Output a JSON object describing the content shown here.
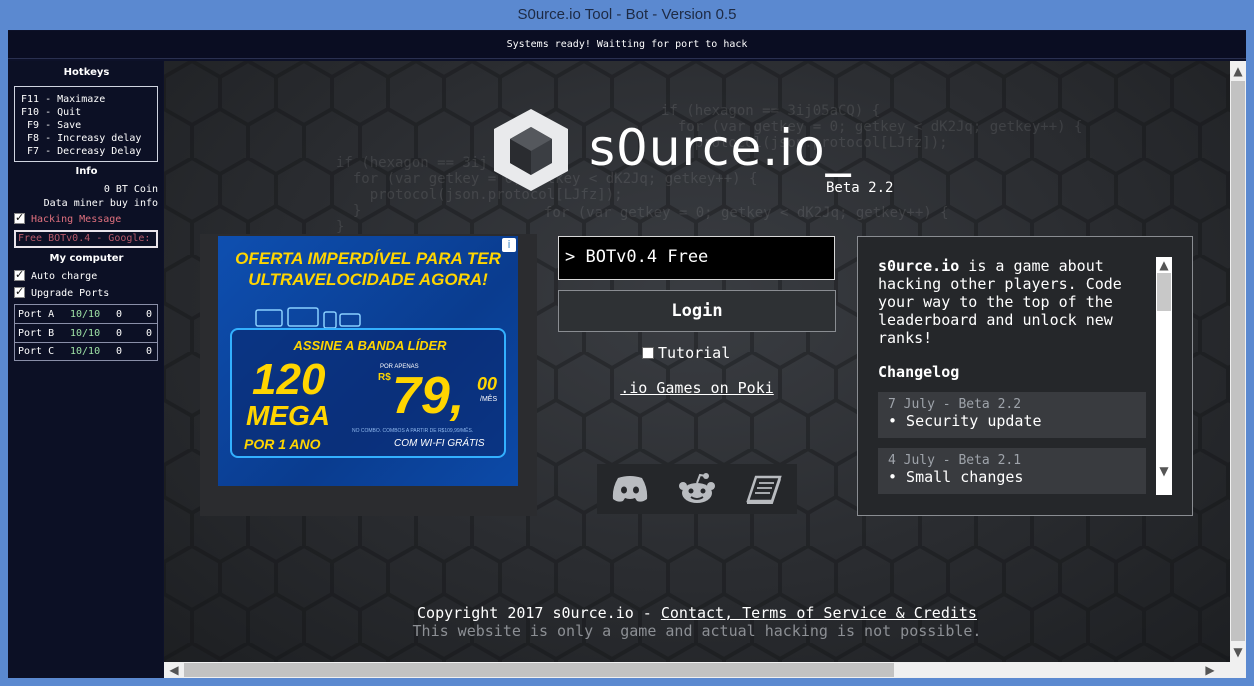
{
  "window": {
    "title": "S0urce.io Tool - Bot - Version 0.5"
  },
  "status": {
    "message": "Systems ready! Waitting for port to hack"
  },
  "left_panel": {
    "hotkeys_title": "Hotkeys",
    "hotkeys": [
      "F11 - Maximaze",
      "F10 - Quit",
      " F9 - Save",
      " F8 - Increasy delay",
      " F7 - Decreasy Delay"
    ],
    "info_title": "Info",
    "coin": "0 BT Coin",
    "data_miner": "Data miner buy info",
    "hacking_message_label": "Hacking Message",
    "hacking_message_value": "Free BOTv0.4 - Google:",
    "my_computer_title": "My computer",
    "auto_charge_label": "Auto charge",
    "upgrade_ports_label": "Upgrade Ports",
    "ports": [
      {
        "name": "Port A",
        "value": "10/10",
        "a": "0",
        "b": "0"
      },
      {
        "name": "Port B",
        "value": "10/10",
        "a": "0",
        "b": "0"
      },
      {
        "name": "Port C",
        "value": "10/10",
        "a": "0",
        "b": "0"
      }
    ]
  },
  "game": {
    "logo_text": "s0urce.io_",
    "beta": "Beta 2.2",
    "bg_code": [
      "if (hexagon == 3ij05aCQ) {\n  for (var getkey = 0; getkey < dK2Jq; getkey++) {\n    protocol(json.protocol[LJfz]);",
      "if (hexagon == 3ij\n  for (var getkey = 0; getkey < dK2Jq; getkey++) {\n    protocol(json.protocol[LJfz]);\n  }\n}",
      "for (var getkey = 0; getkey < dK2Jq; getkey++) {"
    ],
    "name_input_value": "> BOTv0.4 Free",
    "login_label": "Login",
    "tutorial_label": "Tutorial",
    "poki_link": ".io Games on Poki",
    "description_name": "s0urce.io",
    "description_rest": " is a game about hacking other players. Code your way to the top of the leaderboard and unlock new ranks!",
    "changelog_title": "Changelog",
    "changelog": [
      {
        "date": "7 July - Beta 2.2",
        "item": "• Security update"
      },
      {
        "date": "4 July - Beta 2.1",
        "item": "• Small changes"
      }
    ],
    "copyright_prefix": "Copyright 2017 s0urce.io - ",
    "copyright_link": "Contact, Terms of Service & Credits",
    "disclaimer": "This website is only a game and actual hacking is not possible."
  },
  "ad": {
    "headline": "OFERTA IMPERDÍVEL PARA TER ULTRAVELOCIDADE AGORA!",
    "subhead": "ASSINE A BANDA LÍDER",
    "mega_number": "120",
    "mega_label": "MEGA",
    "year": "POR 1 ANO",
    "por_apenas": "POR APENAS",
    "currency": "R$",
    "price": "79,",
    "cents": "00",
    "per_month": "/MÊS",
    "fine_print": "NO COMBO. COMBOS A PARTIR DE R$109,99/MÊS.",
    "wifi": "COM WI-FI GRÁTIS"
  },
  "colors": {
    "titlebar": "#5b89d0",
    "panel_bg": "#0c1025",
    "game_bg": "#2a2c30",
    "port_value": "#9fe3a6",
    "hacking_message": "#b85a6a",
    "ad_yellow": "#ffd500",
    "ad_blue": "#0e4fb0"
  },
  "icons": [
    "discord-icon",
    "reddit-icon",
    "book-icon"
  ]
}
